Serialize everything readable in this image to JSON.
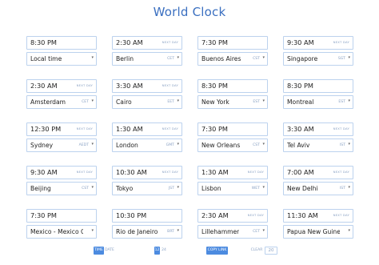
{
  "app": {
    "title": "World Clock"
  },
  "clocks": [
    {
      "time": "8:30 PM",
      "next_day": "",
      "city": "Local time",
      "tz": ""
    },
    {
      "time": "2:30 AM",
      "next_day": "NEXT DAY",
      "city": "Berlin",
      "tz": "CET"
    },
    {
      "time": "7:30 PM",
      "next_day": "",
      "city": "Buenos Aires",
      "tz": "CST"
    },
    {
      "time": "9:30 AM",
      "next_day": "NEXT DAY",
      "city": "Singapore",
      "tz": "SGT"
    },
    {
      "time": "2:30 AM",
      "next_day": "NEXT DAY",
      "city": "Amsterdam",
      "tz": "CET"
    },
    {
      "time": "3:30 AM",
      "next_day": "NEXT DAY",
      "city": "Cairo",
      "tz": "EET"
    },
    {
      "time": "8:30 PM",
      "next_day": "",
      "city": "New York",
      "tz": "EST"
    },
    {
      "time": "8:30 PM",
      "next_day": "",
      "city": "Montreal",
      "tz": "EST"
    },
    {
      "time": "12:30 PM",
      "next_day": "NEXT DAY",
      "city": "Sydney",
      "tz": "AEDT"
    },
    {
      "time": "1:30 AM",
      "next_day": "NEXT DAY",
      "city": "London",
      "tz": "GMT"
    },
    {
      "time": "7:30 PM",
      "next_day": "",
      "city": "New Orleans",
      "tz": "CST"
    },
    {
      "time": "3:30 AM",
      "next_day": "NEXT DAY",
      "city": "Tel Aviv",
      "tz": "IST"
    },
    {
      "time": "9:30 AM",
      "next_day": "NEXT DAY",
      "city": "Beijing",
      "tz": "CST"
    },
    {
      "time": "10:30 AM",
      "next_day": "NEXT DAY",
      "city": "Tokyo",
      "tz": "JST"
    },
    {
      "time": "1:30 AM",
      "next_day": "NEXT DAY",
      "city": "Lisbon",
      "tz": "WET"
    },
    {
      "time": "7:00 AM",
      "next_day": "NEXT DAY",
      "city": "New Delhi",
      "tz": "IST"
    },
    {
      "time": "7:30 PM",
      "next_day": "",
      "city": "Mexico - Mexico City",
      "tz": ""
    },
    {
      "time": "10:30 PM",
      "next_day": "",
      "city": "Rio de Janeiro",
      "tz": "BRT"
    },
    {
      "time": "2:30 AM",
      "next_day": "NEXT DAY",
      "city": "Lillehammer",
      "tz": "CET"
    },
    {
      "time": "11:30 AM",
      "next_day": "NEXT DAY",
      "city": "Papua New Guine...",
      "tz": ""
    }
  ],
  "footer": {
    "time_label": "TIME",
    "date_label": "DATE",
    "h12_label": "12",
    "h24_label": "24",
    "copy_label": "COPY LINK",
    "clear_label": "CLEAR",
    "count": "20"
  },
  "colors": {
    "accent": "#3a6fc0",
    "border": "#bcd2ee",
    "active": "#4c8be0"
  }
}
